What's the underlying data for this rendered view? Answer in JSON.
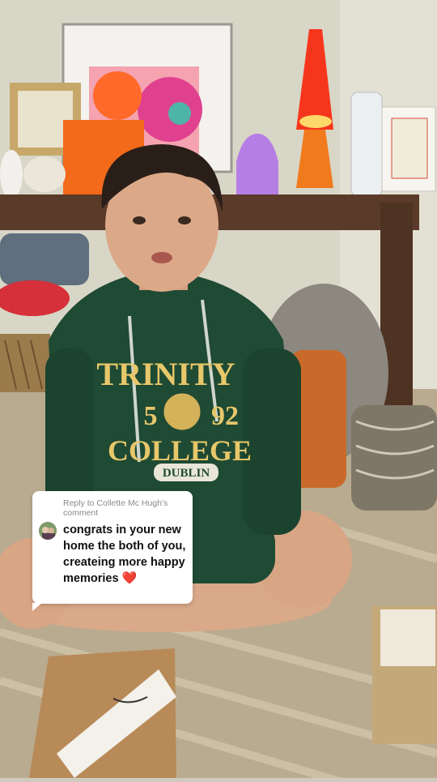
{
  "video": {
    "description_icon": "video-frame"
  },
  "hoodie": {
    "line1": "TRINITY",
    "year_left": "5",
    "year_right": "92",
    "line2": "COLLEGE",
    "line3": "DUBLIN"
  },
  "reply": {
    "header": "Reply to Collette Mc Hugh's comment",
    "comment": "congrats in your new home the both of you, createing more happy memories",
    "heart": "❤️"
  },
  "colors": {
    "hoodie_green": "#1f4a33",
    "hoodie_text": "#e7c76a",
    "card_bg": "#ffffff"
  }
}
